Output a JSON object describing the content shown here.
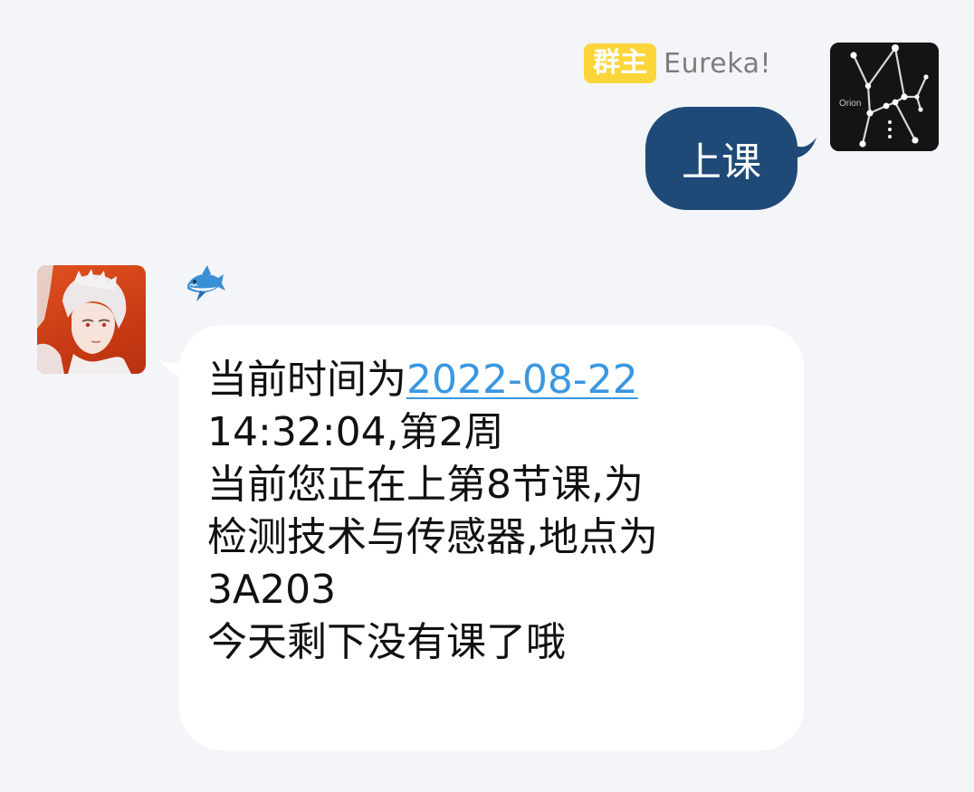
{
  "outgoing_message": {
    "role_badge": "群主",
    "sender_name": "Eureka!",
    "avatar_caption": "Orion",
    "text": "上课",
    "bubble_color": "#1f4a77",
    "badge_color": "#fcd53b"
  },
  "incoming_message": {
    "sender_icon": "shark-icon",
    "avatar_icon": "anime-character-avatar",
    "lines": {
      "line1_prefix": "当前时间为",
      "line1_date": "2022-08-22",
      "line2": "14:32:04,第2周",
      "line3": "当前您正在上第8节课,为",
      "line4": "检测技术与传感器,地点为",
      "line5": "3A203",
      "line6": "今天剩下没有课了哦"
    },
    "link_color": "#3a97e0"
  },
  "background_color": "#f3f5f9"
}
